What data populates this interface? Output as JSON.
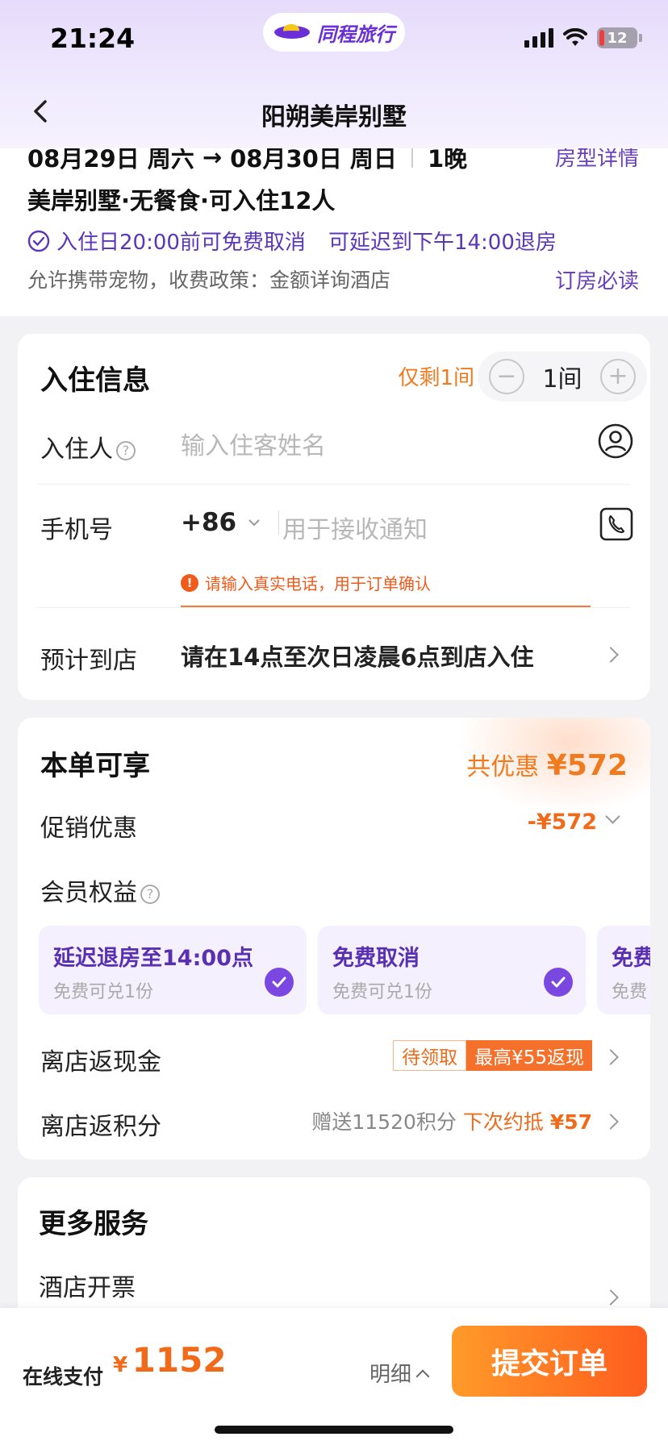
{
  "status_bar": {
    "time": "21:24",
    "battery": "12"
  },
  "brand": {
    "name": "同程旅行"
  },
  "nav": {
    "title": "阳朔美岸别墅"
  },
  "summary": {
    "checkin": "08月29日 周六",
    "arrow": "→",
    "checkout": "08月30日 周日",
    "nights": "1晚",
    "room_detail_link": "房型详情",
    "room_line": "美岸别墅·无餐食·可入住12人",
    "free_cancel": "入住日20:00前可免费取消",
    "late_checkout": "可延迟到下午14:00退房",
    "pet_policy": "允许携带宠物，收费政策：金额详询酒店",
    "must_read_link": "订房必读"
  },
  "guest": {
    "title": "入住信息",
    "only_left": "仅剩1间",
    "room_count": "1间",
    "guest_label": "入住人",
    "guest_placeholder": "输入住客姓名",
    "phone_label": "手机号",
    "country_code": "+86",
    "phone_placeholder": "用于接收通知",
    "warning": "请输入真实电话，用于订单确认",
    "arrival_label": "预计到店",
    "arrival_value": "请在14点至次日凌晨6点到店入住"
  },
  "benefits": {
    "title": "本单可享",
    "total_save_prefix": "共优惠 ",
    "total_save_amount": "¥572",
    "promo_label": "促销优惠",
    "promo_value": "-¥572",
    "member_label": "会员权益",
    "member_cards": [
      {
        "title": "延迟退房至14:00点",
        "sub": "免费可兑1份"
      },
      {
        "title": "免费取消",
        "sub": "免费可兑1份"
      },
      {
        "title": "免费",
        "sub": "免费"
      }
    ],
    "cashback_label": "离店返现金",
    "cashback_tag": "待领取",
    "cashback_max": "最高¥55返现",
    "points_label": "离店返积分",
    "points_give": "赠送11520积分 ",
    "points_next": "下次约抵 ",
    "points_value": "¥57"
  },
  "more": {
    "title": "更多服务",
    "invoice_label": "酒店开票"
  },
  "bottom": {
    "pay_label": "在线支付",
    "currency": "¥",
    "amount": "1152",
    "detail": "明细",
    "submit": "提交订单"
  },
  "colors": {
    "accent_purple": "#6a3fbf",
    "accent_orange": "#f06a1a",
    "button_gradient_start": "#ff9a2a",
    "button_gradient_end": "#ff5d1d"
  }
}
